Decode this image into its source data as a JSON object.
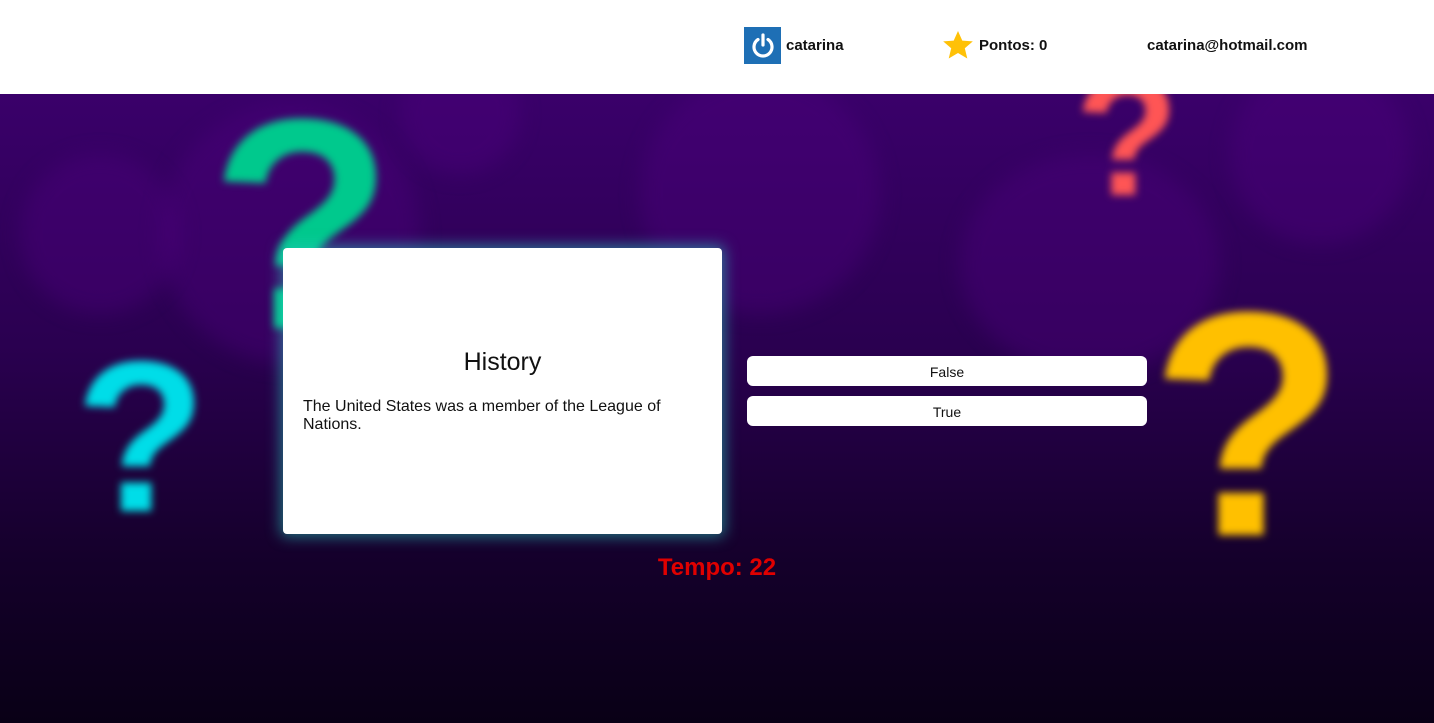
{
  "header": {
    "username": "catarina",
    "points_label": "Pontos: 0",
    "email": "catarina@hotmail.com",
    "user_icon": "power-icon",
    "points_icon": "star-icon"
  },
  "background": {
    "decorations": [
      "?",
      "?",
      "?",
      "?"
    ],
    "colors": {
      "green": "#00c98d",
      "cyan": "#00dde8",
      "red": "#ff5555",
      "yellow": "#ffc000"
    }
  },
  "question_card": {
    "category": "History",
    "question": "The United States was a member of the League of Nations."
  },
  "answers": [
    {
      "label": "False"
    },
    {
      "label": "True"
    }
  ],
  "timer": {
    "label": "Tempo: 22"
  },
  "colors": {
    "power_button": "#1e6fb5",
    "star": "#ffc107",
    "timer": "#e00000",
    "card_glow": "#28c8be"
  }
}
